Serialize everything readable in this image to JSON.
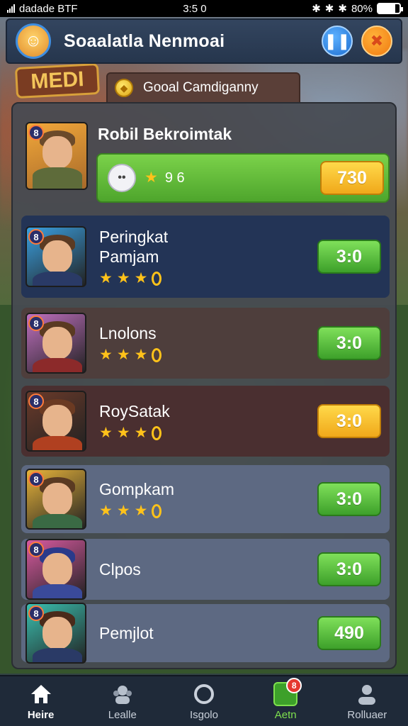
{
  "status_bar": {
    "carrier": "dadade BTF",
    "time": "3:5 0",
    "battery": "80%",
    "battery_level": 0.8
  },
  "header": {
    "title": "Soaalatla Nenmoai",
    "pause_icon": "pause-icon",
    "close_icon": "close-icon"
  },
  "background": {
    "sign_text": "MEDI"
  },
  "tab": {
    "label": "Gooal Camdiganny",
    "icon": "coin-icon"
  },
  "featured": {
    "rank": "8",
    "name": "Robil Bekroimtak",
    "stats": "9 6",
    "score": "730",
    "bar_color": "#5fb83a"
  },
  "leaderboard": [
    {
      "rank": "8",
      "name_line1": "Peringkat",
      "name_line2": "Pamjam",
      "stars": 3,
      "trail": "0",
      "score": "3:0",
      "button_color": "green",
      "row_color": "#233456"
    },
    {
      "rank": "8",
      "name_line1": "Lnolons",
      "name_line2": "",
      "stars": 3,
      "trail": "0",
      "score": "3:0",
      "button_color": "green",
      "row_color": "#4e3e3c"
    },
    {
      "rank": "8",
      "name_line1": "RoySatak",
      "name_line2": "",
      "stars": 3,
      "trail": "0",
      "score": "3:0",
      "button_color": "yellow",
      "row_color": "#4a2f30"
    },
    {
      "rank": "8",
      "name_line1": "Gompkam",
      "name_line2": "",
      "stars": 3,
      "trail": "0",
      "score": "3:0",
      "button_color": "green",
      "row_color": "#5d6982"
    },
    {
      "rank": "8",
      "name_line1": "Clpos",
      "name_line2": "",
      "stars": 0,
      "trail": "0",
      "score": "3:0",
      "button_color": "green",
      "row_color": "#5d6982"
    },
    {
      "rank": "8",
      "name_line1": "Pemjlot",
      "name_line2": "",
      "stars": 0,
      "trail": "",
      "score": "490",
      "button_color": "green",
      "row_color": "#5d6982"
    }
  ],
  "nav": [
    {
      "label": "Heire",
      "icon": "home-icon",
      "badge": ""
    },
    {
      "label": "Lealle",
      "icon": "guild-icon",
      "badge": ""
    },
    {
      "label": "Isgolo",
      "icon": "ring-icon",
      "badge": ""
    },
    {
      "label": "Aetn",
      "icon": "shop-icon",
      "badge": "8"
    },
    {
      "label": "Rolluaer",
      "icon": "profile-icon",
      "badge": ""
    }
  ]
}
